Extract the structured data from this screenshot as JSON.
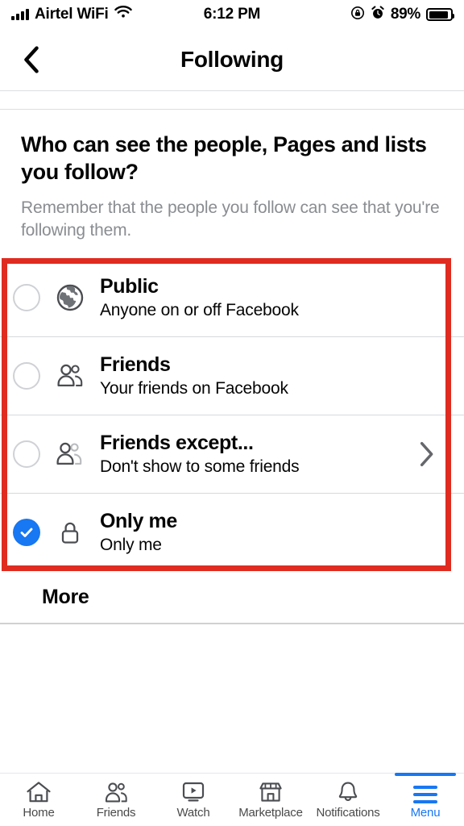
{
  "status_bar": {
    "carrier": "Airtel WiFi",
    "time": "6:12 PM",
    "battery_percent": "89%",
    "icons": [
      "signal-bars-icon",
      "wifi-icon",
      "rotation-lock-icon",
      "alarm-clock-icon",
      "battery-icon"
    ]
  },
  "header": {
    "title": "Following",
    "back_icon": "chevron-left-icon"
  },
  "question": {
    "title": "Who can see the people, Pages and lists you follow?",
    "subtitle": "Remember that the people you follow can see that you're following them."
  },
  "options": [
    {
      "label": "Public",
      "description": "Anyone on or off Facebook",
      "icon": "globe-icon",
      "selected": false,
      "has_chevron": false
    },
    {
      "label": "Friends",
      "description": "Your friends on Facebook",
      "icon": "friends-icon",
      "selected": false,
      "has_chevron": false
    },
    {
      "label": "Friends except...",
      "description": "Don't show to some friends",
      "icon": "friends-except-icon",
      "selected": false,
      "has_chevron": true
    },
    {
      "label": "Only me",
      "description": "Only me",
      "icon": "lock-icon",
      "selected": true,
      "has_chevron": false
    }
  ],
  "more": {
    "label": "More"
  },
  "bottom_nav": {
    "items": [
      {
        "label": "Home",
        "icon": "home-icon",
        "active": false
      },
      {
        "label": "Friends",
        "icon": "friends-icon",
        "active": false
      },
      {
        "label": "Watch",
        "icon": "watch-play-icon",
        "active": false
      },
      {
        "label": "Marketplace",
        "icon": "marketplace-store-icon",
        "active": false
      },
      {
        "label": "Notifications",
        "icon": "bell-icon",
        "active": false
      },
      {
        "label": "Menu",
        "icon": "hamburger-menu-icon",
        "active": true
      }
    ]
  },
  "colors": {
    "accent": "#1877f2",
    "highlight_box": "#e02b20",
    "muted_text": "#8a8d91",
    "divider": "#d7d9dc"
  }
}
